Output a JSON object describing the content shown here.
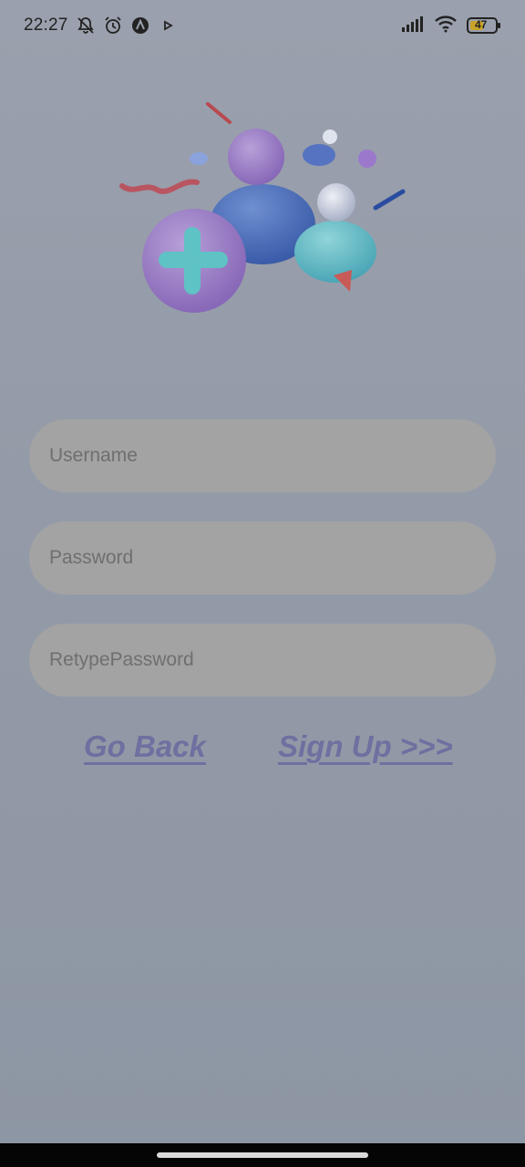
{
  "status_bar": {
    "time": "22:27",
    "battery_level": "47",
    "icons": [
      "bell-off-icon",
      "alarm-icon",
      "app-a-icon",
      "play-icon",
      "signal-icon",
      "wifi-icon",
      "battery-icon"
    ]
  },
  "form": {
    "username": {
      "placeholder": "Username",
      "value": ""
    },
    "password": {
      "placeholder": "Password",
      "value": ""
    },
    "retype_password": {
      "placeholder": "RetypePassword",
      "value": ""
    }
  },
  "actions": {
    "go_back_label": "Go Back",
    "sign_up_label": "Sign Up >>>"
  },
  "colors": {
    "background": "#939aa7",
    "field_background": "#a3a3a4",
    "link_color": "#6f6fa0",
    "nav_bar": "#050505"
  }
}
